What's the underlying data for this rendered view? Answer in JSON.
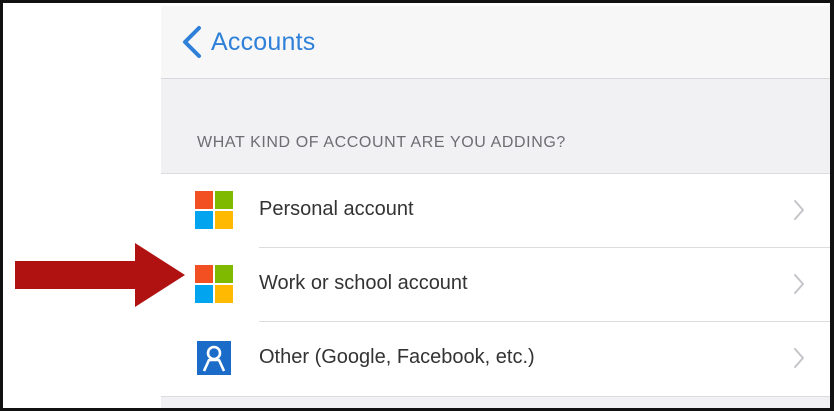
{
  "nav": {
    "back_label": "Accounts",
    "back_icon": "chevron-left-icon"
  },
  "section": {
    "header": "WHAT KIND OF ACCOUNT ARE YOU ADDING?"
  },
  "accounts": [
    {
      "label": "Personal account",
      "icon": "microsoft-logo-icon"
    },
    {
      "label": "Work or school account",
      "icon": "microsoft-logo-icon"
    },
    {
      "label": "Other (Google, Facebook, etc.)",
      "icon": "person-icon"
    }
  ],
  "colors": {
    "ios_blue": "#2f80d8",
    "ms_red": "#f25022",
    "ms_green": "#7fba00",
    "ms_blue": "#00a4ef",
    "ms_yellow": "#ffb900",
    "person_icon_bg": "#1b6cc8",
    "arrow_red": "#b01212",
    "chevron_gray": "#c4c4c9"
  }
}
